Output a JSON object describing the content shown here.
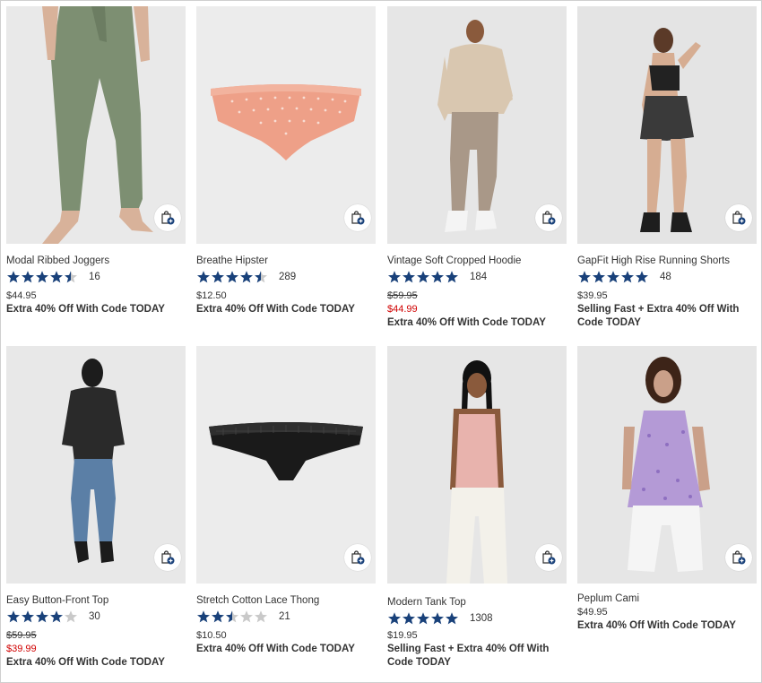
{
  "colors": {
    "star": "#19417a",
    "sale": "#d00000",
    "bag": "#19417a"
  },
  "products": [
    {
      "name": "Modal Ribbed Joggers",
      "rating": 4.5,
      "reviews": "16",
      "price": "$44.95",
      "original_price": "",
      "sale_price": "",
      "promo": "Extra 40% Off With Code TODAY",
      "promo2": ""
    },
    {
      "name": "Breathe Hipster",
      "rating": 4.5,
      "reviews": "289",
      "price": "$12.50",
      "original_price": "",
      "sale_price": "",
      "promo": "Extra 40% Off With Code TODAY",
      "promo2": ""
    },
    {
      "name": "Vintage Soft Cropped Hoodie",
      "rating": 5,
      "reviews": "184",
      "price": "",
      "original_price": "$59.95",
      "sale_price": "$44.99",
      "promo": "Extra 40% Off With Code TODAY",
      "promo2": ""
    },
    {
      "name": "GapFit High Rise Running Shorts",
      "rating": 5,
      "reviews": "48",
      "price": "$39.95",
      "original_price": "",
      "sale_price": "",
      "promo": "Selling Fast + Extra 40% Off With",
      "promo2": "Code TODAY"
    },
    {
      "name": "Easy Button-Front Top",
      "rating": 4,
      "reviews": "30",
      "price": "",
      "original_price": "$59.95",
      "sale_price": "$39.99",
      "promo": "Extra 40% Off With Code TODAY",
      "promo2": ""
    },
    {
      "name": "Stretch Cotton Lace Thong",
      "rating": 2.5,
      "reviews": "21",
      "price": "$10.50",
      "original_price": "",
      "sale_price": "",
      "promo": "Extra 40% Off With Code TODAY",
      "promo2": ""
    },
    {
      "name": "Modern Tank Top",
      "rating": 5,
      "reviews": "1308",
      "price": "$19.95",
      "original_price": "",
      "sale_price": "",
      "promo": "Selling Fast + Extra 40% Off With",
      "promo2": "Code TODAY"
    },
    {
      "name": "Peplum Cami",
      "rating": null,
      "reviews": "",
      "price": "$49.95",
      "original_price": "",
      "sale_price": "",
      "promo": "Extra 40% Off With Code TODAY",
      "promo2": ""
    }
  ]
}
